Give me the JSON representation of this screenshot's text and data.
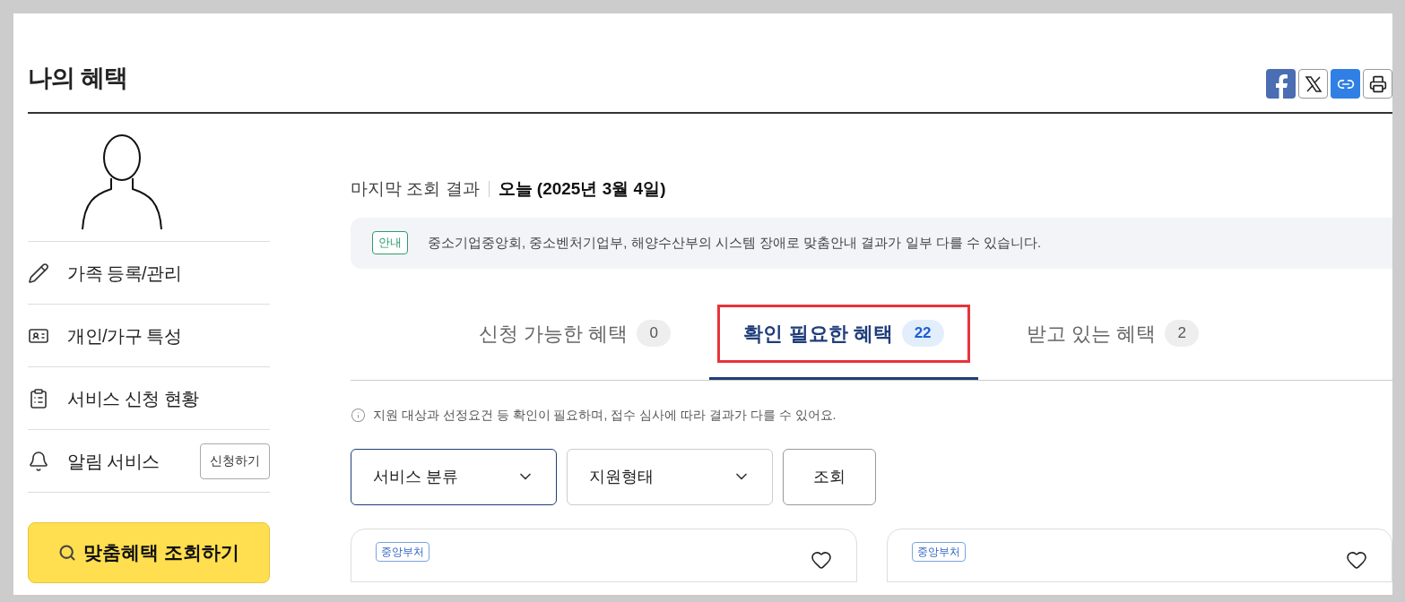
{
  "page_title": "나의 혜택",
  "share_buttons": [
    {
      "kind": "facebook"
    },
    {
      "kind": "x"
    },
    {
      "kind": "link"
    },
    {
      "kind": "print"
    }
  ],
  "sidebar": {
    "items": [
      {
        "kind": "pencil",
        "label": "가족 등록/관리"
      },
      {
        "kind": "id-card",
        "label": "개인/가구 특성"
      },
      {
        "kind": "clipboard",
        "label": "서비스 신청 현황"
      },
      {
        "kind": "bell",
        "label": "알림 서비스",
        "button": "신청하기"
      }
    ],
    "search_button": "맞춤혜택 조회하기"
  },
  "last_query": {
    "label": "마지막 조회 결과",
    "value": "오늘 (2025년 3월 4일)"
  },
  "notice": {
    "badge": "안내",
    "text": "중소기업중앙회, 중소벤처기업부, 해양수산부의 시스템 장애로 맞춤안내 결과가 일부 다를 수 있습니다."
  },
  "tabs": [
    {
      "label": "신청 가능한 혜택",
      "count": "0",
      "selected": false,
      "highlighted": false
    },
    {
      "label": "확인 필요한 혜택",
      "count": "22",
      "selected": true,
      "highlighted": true
    },
    {
      "label": "받고 있는 혜택",
      "count": "2",
      "selected": false,
      "highlighted": false
    }
  ],
  "info_text": "지원 대상과 선정요건 등 확인이 필요하며, 접수 심사에 따라 결과가 다를 수 있어요.",
  "filters": [
    {
      "label": "서비스 분류",
      "focused": true
    },
    {
      "label": "지원형태",
      "focused": false
    }
  ],
  "query_button": "조회",
  "cards": [
    {
      "tag": "중앙부처"
    },
    {
      "tag": "중앙부처"
    }
  ]
}
